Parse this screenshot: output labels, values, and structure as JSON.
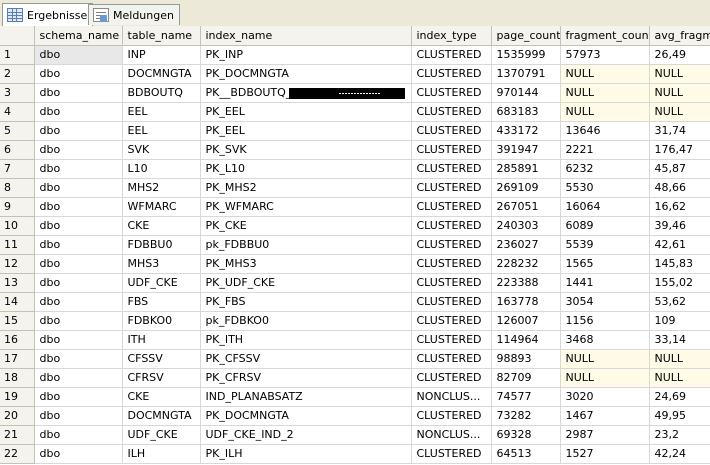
{
  "tabs": [
    {
      "label": "Ergebnisse",
      "icon": "results-grid-icon",
      "active": true
    },
    {
      "label": "Meldungen",
      "icon": "messages-icon",
      "active": false
    }
  ],
  "columns": [
    "schema_name",
    "table_name",
    "index_name",
    "index_type",
    "page_count",
    "fragment_count",
    "avg_fragme"
  ],
  "rows": [
    {
      "n": "1",
      "cells": [
        "dbo",
        "INP",
        "PK_INP",
        "CLUSTERED",
        "1535999",
        "57973",
        "26,49"
      ]
    },
    {
      "n": "2",
      "cells": [
        "dbo",
        "DOCMNGTA",
        "PK_DOCMNGTA",
        "CLUSTERED",
        "1370791",
        "NULL",
        "NULL"
      ]
    },
    {
      "n": "3",
      "cells": [
        "dbo",
        "BDBOUTQ",
        "PK__BDBOUTQ_",
        "CLUSTERED",
        "970144",
        "NULL",
        "NULL"
      ]
    },
    {
      "n": "4",
      "cells": [
        "dbo",
        "EEL",
        "PK_EEL",
        "CLUSTERED",
        "683183",
        "NULL",
        "NULL"
      ]
    },
    {
      "n": "5",
      "cells": [
        "dbo",
        "EEL",
        "PK_EEL",
        "CLUSTERED",
        "433172",
        "13646",
        "31,74"
      ]
    },
    {
      "n": "6",
      "cells": [
        "dbo",
        "SVK",
        "PK_SVK",
        "CLUSTERED",
        "391947",
        "2221",
        "176,47"
      ]
    },
    {
      "n": "7",
      "cells": [
        "dbo",
        "L10",
        "PK_L10",
        "CLUSTERED",
        "285891",
        "6232",
        "45,87"
      ]
    },
    {
      "n": "8",
      "cells": [
        "dbo",
        "MHS2",
        "PK_MHS2",
        "CLUSTERED",
        "269109",
        "5530",
        "48,66"
      ]
    },
    {
      "n": "9",
      "cells": [
        "dbo",
        "WFMARC",
        "PK_WFMARC",
        "CLUSTERED",
        "267051",
        "16064",
        "16,62"
      ]
    },
    {
      "n": "10",
      "cells": [
        "dbo",
        "CKE",
        "PK_CKE",
        "CLUSTERED",
        "240303",
        "6089",
        "39,46"
      ]
    },
    {
      "n": "11",
      "cells": [
        "dbo",
        "FDBBU0",
        "pk_FDBBU0",
        "CLUSTERED",
        "236027",
        "5539",
        "42,61"
      ]
    },
    {
      "n": "12",
      "cells": [
        "dbo",
        "MHS3",
        "PK_MHS3",
        "CLUSTERED",
        "228232",
        "1565",
        "145,83"
      ]
    },
    {
      "n": "13",
      "cells": [
        "dbo",
        "UDF_CKE",
        "PK_UDF_CKE",
        "CLUSTERED",
        "223388",
        "1441",
        "155,02"
      ]
    },
    {
      "n": "14",
      "cells": [
        "dbo",
        "FBS",
        "PK_FBS",
        "CLUSTERED",
        "163778",
        "3054",
        "53,62"
      ]
    },
    {
      "n": "15",
      "cells": [
        "dbo",
        "FDBKO0",
        "pk_FDBKO0",
        "CLUSTERED",
        "126007",
        "1156",
        "109"
      ]
    },
    {
      "n": "16",
      "cells": [
        "dbo",
        "ITH",
        "PK_ITH",
        "CLUSTERED",
        "114964",
        "3468",
        "33,14"
      ]
    },
    {
      "n": "17",
      "cells": [
        "dbo",
        "CFSSV",
        "PK_CFSSV",
        "CLUSTERED",
        "98893",
        "NULL",
        "NULL"
      ]
    },
    {
      "n": "18",
      "cells": [
        "dbo",
        "CFRSV",
        "PK_CFRSV",
        "CLUSTERED",
        "82709",
        "NULL",
        "NULL"
      ]
    },
    {
      "n": "19",
      "cells": [
        "dbo",
        "CKE",
        "IND_PLANABSATZ",
        "NONCLUS...",
        "74577",
        "3020",
        "24,69"
      ]
    },
    {
      "n": "20",
      "cells": [
        "dbo",
        "DOCMNGTA",
        "PK_DOCMNGTA",
        "CLUSTERED",
        "73282",
        "1467",
        "49,95"
      ]
    },
    {
      "n": "21",
      "cells": [
        "dbo",
        "UDF_CKE",
        "UDF_CKE_IND_2",
        "NONCLUS...",
        "69328",
        "2987",
        "23,2"
      ]
    },
    {
      "n": "22",
      "cells": [
        "dbo",
        "ILH",
        "PK_ILH",
        "CLUSTERED",
        "64513",
        "1527",
        "42,24"
      ]
    }
  ],
  "colors": {
    "null_cell_bg": "#fffbe6",
    "selected_cell_bg": "#e8e8e8",
    "header_bg": "#f4f3ee"
  }
}
